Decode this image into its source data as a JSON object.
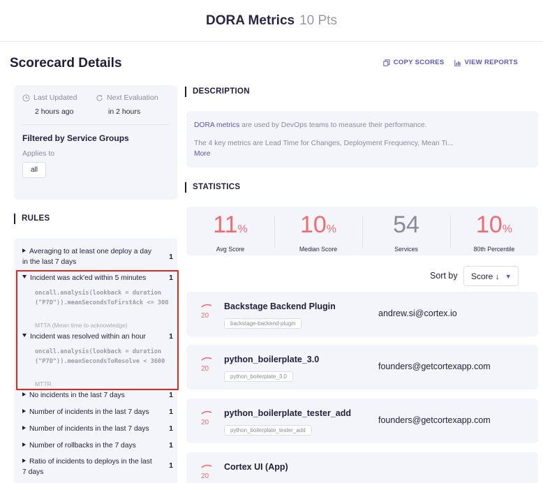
{
  "header": {
    "title": "DORA Metrics",
    "points": "10 Pts"
  },
  "page": {
    "title": "Scorecard Details"
  },
  "actions": {
    "copy_scores": "COPY SCORES",
    "view_reports": "VIEW REPORTS"
  },
  "info": {
    "last_updated_label": "Last Updated",
    "last_updated_value": "2 hours ago",
    "next_evaluation_label": "Next Evaluation",
    "next_evaluation_value": "in 2 hours",
    "filtered_title": "Filtered by Service Groups",
    "applies_to": "Applies to",
    "group_chip": "all"
  },
  "sections": {
    "rules": "RULES",
    "description": "DESCRIPTION",
    "statistics": "STATISTICS"
  },
  "rules": [
    {
      "label": "Averaging to at least one deploy a day in the last 7 days",
      "count": "1",
      "expanded": false
    },
    {
      "label": "Incident was ack'ed within 5 minutes",
      "count": "1",
      "expanded": true,
      "query": "oncall.analysis(lookback = duration(\"P7D\")).meanSecondsToFirstAck <= 300",
      "description": "MTTA (Mean time to acknowledge)"
    },
    {
      "label": "Incident was resolved within an hour",
      "count": "1",
      "expanded": true,
      "query": "oncall.analysis(lookback = duration(\"P7D\")).meanSecondsToResolve < 3600",
      "description": "MTTR"
    },
    {
      "label": "No incidents in the last 7 days",
      "count": "1",
      "expanded": false
    },
    {
      "label": "Number of incidents in the last 7 days",
      "count": "1",
      "expanded": false
    },
    {
      "label": "Number of incidents in the last 7 days",
      "count": "1",
      "expanded": false
    },
    {
      "label": "Number of rollbacks in the 7 days",
      "count": "1",
      "expanded": false
    },
    {
      "label": "Ratio of incidents to deploys in the last 7 days",
      "count": "1",
      "expanded": false
    }
  ],
  "description": {
    "link_text": "DORA metrics",
    "line1_rest": " are used by DevOps teams to measure their performance.",
    "line2": "The 4 key metrics are Lead Time for Changes, Deployment Frequency, Mean Ti...",
    "more": "More"
  },
  "statistics": [
    {
      "value": "11",
      "unit": "%",
      "label": "Avg Score",
      "color": "#ee6b72"
    },
    {
      "value": "10",
      "unit": "%",
      "label": "Median Score",
      "color": "#ee6b72"
    },
    {
      "value": "54",
      "unit": "",
      "label": "Services",
      "color": "#8a8a9d"
    },
    {
      "value": "10",
      "unit": "%",
      "label": "80th Percentile",
      "color": "#ee6b72"
    }
  ],
  "sort": {
    "label": "Sort by",
    "value": "Score ↓"
  },
  "services": [
    {
      "name": "Backstage Backend Plugin",
      "tag": "backstage-backend-plugin",
      "owner": "andrew.si@cortex.io",
      "score": "20"
    },
    {
      "name": "python_boilerplate_3.0",
      "tag": "python_boilerplate_3.0",
      "owner": "founders@getcortexapp.com",
      "score": "20"
    },
    {
      "name": "python_boilerplate_tester_add",
      "tag": "python_boilerplate_tester_add",
      "owner": "founders@getcortexapp.com",
      "score": "20"
    },
    {
      "name": "Cortex UI (App)",
      "tag": "",
      "owner": "",
      "score": "20"
    }
  ],
  "colors": {
    "accent": "#5a54b4",
    "score_red": "#ee6b72",
    "highlight": "#e0281c",
    "card_bg": "#f3f5fb"
  }
}
